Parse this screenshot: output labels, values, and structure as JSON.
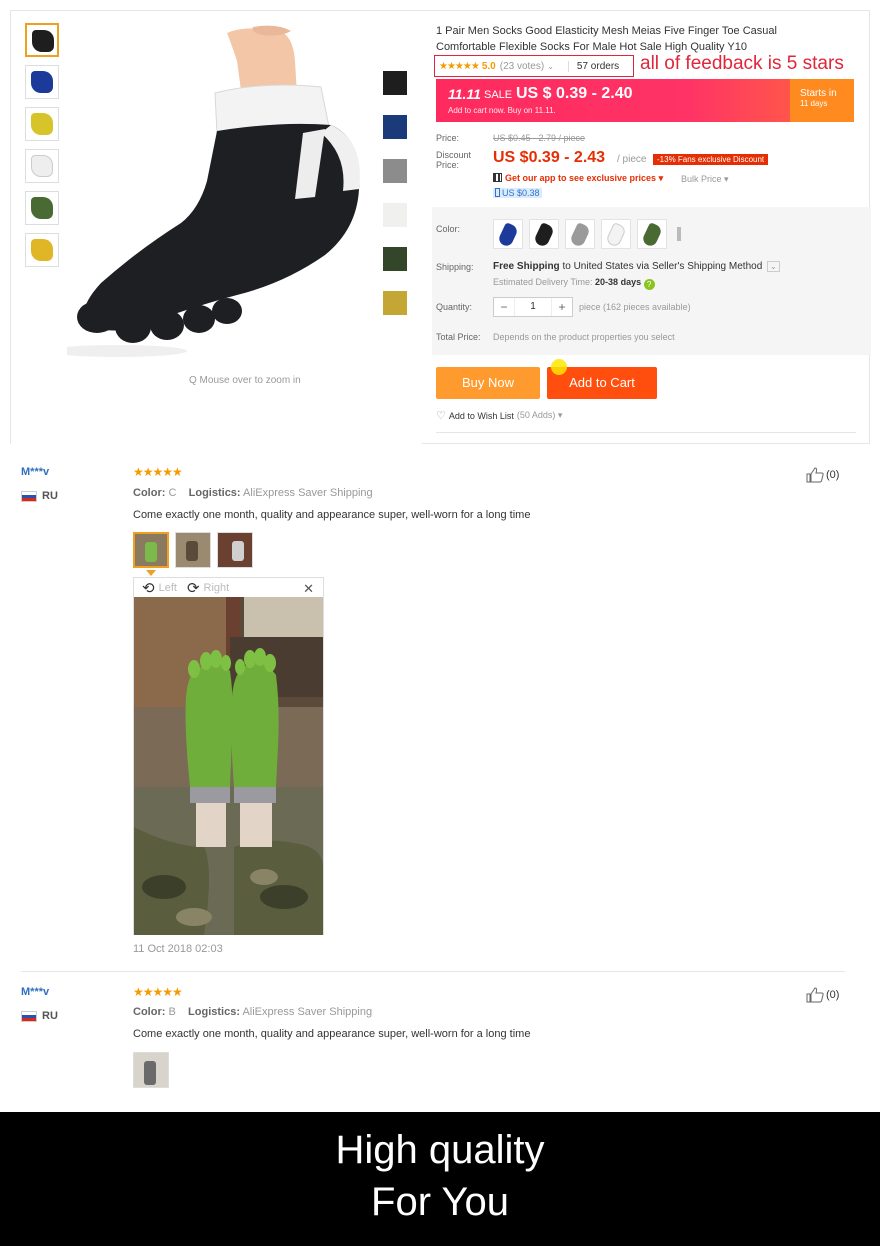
{
  "product": {
    "title": "1 Pair Men Socks Good Elasticity Mesh Meias Five Finger Toe Casual Comfortable Flexible Socks For Male Hot Sale High Quality Y10",
    "stars": "★★★★★",
    "rating": "5.0",
    "votes": "(23 votes)",
    "orders": "57 orders",
    "annotation": "all of feedback is 5 stars",
    "zoom_hint": "Q Mouse over to zoom in"
  },
  "sale": {
    "brand": "11.11",
    "word": "SALE",
    "price": "US $ 0.39 - 2.40",
    "sub": "Add to cart now. Buy on 11.11.",
    "starts_label": "Starts in",
    "starts_days": "11 days"
  },
  "pricing": {
    "price_label": "Price:",
    "old_price": "US $0.45 - 2.79 / piece",
    "discount_label": "Discount Price:",
    "discount_price": "US $0.39 - 2.43",
    "per_piece": "/ piece",
    "fans_badge": "-13% Fans exclusive Discount",
    "app_text": "Get our app to see exclusive prices ▾",
    "bulk": "Bulk Price ▾",
    "mobile_price": "US $0.38"
  },
  "options": {
    "color_label": "Color:",
    "shipping_label": "Shipping:",
    "shipping_bold": "Free Shipping",
    "shipping_text": "to United States via Seller's Shipping Method",
    "estimated_label": "Estimated Delivery Time:",
    "estimated_days": "20-38 days",
    "quantity_label": "Quantity:",
    "quantity_minus": "−",
    "quantity_value": "1",
    "quantity_plus": "+",
    "quantity_avail": "piece (162 pieces available)",
    "total_label": "Total Price:",
    "total_hint": "Depends on the product properties you select"
  },
  "actions": {
    "buy_now": "Buy Now",
    "add_to_cart": "Add to Cart",
    "wish": "Add to Wish List",
    "wish_count": "(50 Adds) ▾"
  },
  "colors": {
    "black": "#1e1e1e",
    "navy": "#1b3a7a",
    "gray": "#8c8c8c",
    "white": "#f0f0ee",
    "army": "#33462a",
    "mustard": "#c3a633",
    "accent": "#ff4e0e",
    "star": "#f59b00"
  },
  "reviews": [
    {
      "user": "M***v",
      "country": "RU",
      "stars": "★★★★★",
      "color_label": "Color:",
      "color": "C",
      "logistics_label": "Logistics:",
      "logistics": "AliExpress Saver Shipping",
      "text": "Come exactly one month, quality and appearance super, well-worn for a long time",
      "likes": "(0)",
      "viewer_left": "Left",
      "viewer_right": "Right",
      "date": "11 Oct 2018 02:03"
    },
    {
      "user": "M***v",
      "country": "RU",
      "stars": "★★★★★",
      "color_label": "Color:",
      "color": "B",
      "logistics_label": "Logistics:",
      "logistics": "AliExpress Saver Shipping",
      "text": "Come exactly one month, quality and appearance super, well-worn for a long time",
      "likes": "(0)"
    }
  ],
  "footer": {
    "line1": "High quality",
    "line2": "For You"
  }
}
